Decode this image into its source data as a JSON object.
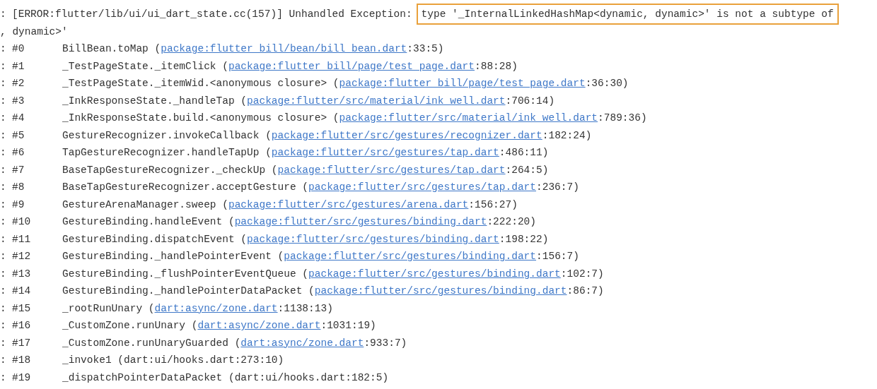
{
  "log": {
    "error_line": {
      "prefix": ":",
      "text": "[ERROR:flutter/lib/ui/ui_dart_state.cc(157)] Unhandled Exception:",
      "highlight": "type '_InternalLinkedHashMap<dynamic, dynamic>' is not a subtype of"
    },
    "continuation": ", dynamic>'",
    "frames": [
      {
        "prefix": ":",
        "number": "#0",
        "kind": "link",
        "call": "BillBean.toMap (",
        "link": "package:flutter_bill/bean/bill_bean.dart",
        "after": ":33:5)"
      },
      {
        "prefix": ":",
        "number": "#1",
        "kind": "link",
        "call": "_TestPageState._itemClick (",
        "link": "package:flutter_bill/page/test_page.dart",
        "after": ":88:28)"
      },
      {
        "prefix": ":",
        "number": "#2",
        "kind": "link",
        "call": "_TestPageState._itemWid.<anonymous closure> (",
        "link": "package:flutter_bill/page/test_page.dart",
        "after": ":36:30)"
      },
      {
        "prefix": ":",
        "number": "#3",
        "kind": "link",
        "call": "_InkResponseState._handleTap (",
        "link": "package:flutter/src/material/ink_well.dart",
        "after": ":706:14)"
      },
      {
        "prefix": ":",
        "number": "#4",
        "kind": "link",
        "call": "_InkResponseState.build.<anonymous closure> (",
        "link": "package:flutter/src/material/ink_well.dart",
        "after": ":789:36)"
      },
      {
        "prefix": ":",
        "number": "#5",
        "kind": "link",
        "call": "GestureRecognizer.invokeCallback (",
        "link": "package:flutter/src/gestures/recognizer.dart",
        "after": ":182:24)"
      },
      {
        "prefix": ":",
        "number": "#6",
        "kind": "link",
        "call": "TapGestureRecognizer.handleTapUp (",
        "link": "package:flutter/src/gestures/tap.dart",
        "after": ":486:11)"
      },
      {
        "prefix": ":",
        "number": "#7",
        "kind": "link",
        "call": "BaseTapGestureRecognizer._checkUp (",
        "link": "package:flutter/src/gestures/tap.dart",
        "after": ":264:5)"
      },
      {
        "prefix": ":",
        "number": "#8",
        "kind": "link",
        "call": "BaseTapGestureRecognizer.acceptGesture (",
        "link": "package:flutter/src/gestures/tap.dart",
        "after": ":236:7)"
      },
      {
        "prefix": ":",
        "number": "#9",
        "kind": "link",
        "call": "GestureArenaManager.sweep (",
        "link": "package:flutter/src/gestures/arena.dart",
        "after": ":156:27)"
      },
      {
        "prefix": ":",
        "number": "#10",
        "kind": "link",
        "call": "GestureBinding.handleEvent (",
        "link": "package:flutter/src/gestures/binding.dart",
        "after": ":222:20)"
      },
      {
        "prefix": ":",
        "number": "#11",
        "kind": "link",
        "call": "GestureBinding.dispatchEvent (",
        "link": "package:flutter/src/gestures/binding.dart",
        "after": ":198:22)"
      },
      {
        "prefix": ":",
        "number": "#12",
        "kind": "link",
        "call": "GestureBinding._handlePointerEvent (",
        "link": "package:flutter/src/gestures/binding.dart",
        "after": ":156:7)"
      },
      {
        "prefix": ":",
        "number": "#13",
        "kind": "link",
        "call": "GestureBinding._flushPointerEventQueue (",
        "link": "package:flutter/src/gestures/binding.dart",
        "after": ":102:7)"
      },
      {
        "prefix": ":",
        "number": "#14",
        "kind": "link",
        "call": "GestureBinding._handlePointerDataPacket (",
        "link": "package:flutter/src/gestures/binding.dart",
        "after": ":86:7)"
      },
      {
        "prefix": ":",
        "number": "#15",
        "kind": "link",
        "call": "_rootRunUnary (",
        "link": "dart:async/zone.dart",
        "after": ":1138:13)"
      },
      {
        "prefix": ":",
        "number": "#16",
        "kind": "link",
        "call": "_CustomZone.runUnary (",
        "link": "dart:async/zone.dart",
        "after": ":1031:19)"
      },
      {
        "prefix": ":",
        "number": "#17",
        "kind": "link",
        "call": "_CustomZone.runUnaryGuarded (",
        "link": "dart:async/zone.dart",
        "after": ":933:7)"
      },
      {
        "prefix": ":",
        "number": "#18",
        "kind": "plain",
        "call": "_invoke1 (dart:ui/hooks.dart:273:10)"
      },
      {
        "prefix": ":",
        "number": "#19",
        "kind": "plain",
        "call": "_dispatchPointerDataPacket (dart:ui/hooks.dart:182:5)"
      }
    ]
  }
}
